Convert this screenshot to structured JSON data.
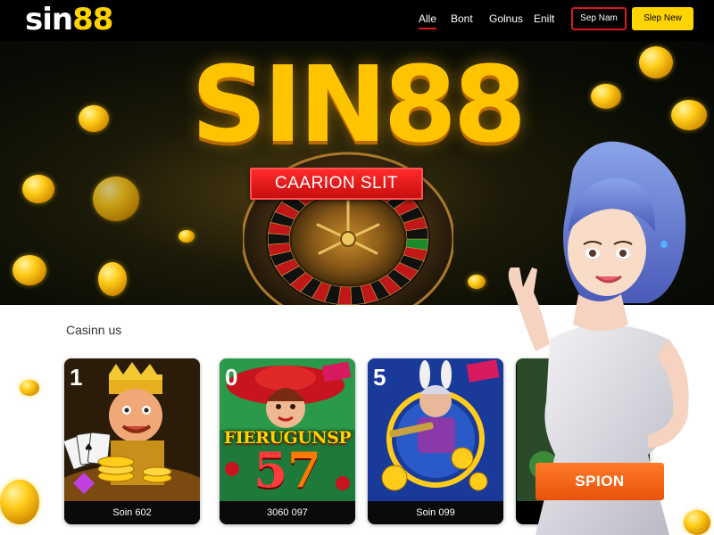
{
  "header": {
    "logo_white": "sin",
    "logo_yellow": "88",
    "nav": [
      "Alle",
      "Bont",
      "Golnus",
      "Enilt"
    ],
    "sign_in_label": "Sep Nam",
    "sign_up_label": "Slep New"
  },
  "hero": {
    "title": "SIN88",
    "button_label": "CAARION SLIT"
  },
  "section": {
    "title": "Casinn us"
  },
  "cards": [
    {
      "badge": "1",
      "caption": "Soin 602"
    },
    {
      "badge": "0",
      "caption": "3060 097",
      "art_title": "FIERUGUNSP",
      "art_number_a": "5",
      "art_number_b": "7"
    },
    {
      "badge": "5",
      "caption": "Soin 099"
    }
  ],
  "cta": {
    "spin_label": "SPION"
  },
  "colors": {
    "brand_yellow": "#ffd200",
    "accent_red": "#d81b1b",
    "cta_orange": "#f26618",
    "header_bg": "#000000"
  },
  "icons": [
    "roulette-wheel-icon",
    "gold-coin-icon",
    "mascot-illustration",
    "playing-cards-icon"
  ]
}
